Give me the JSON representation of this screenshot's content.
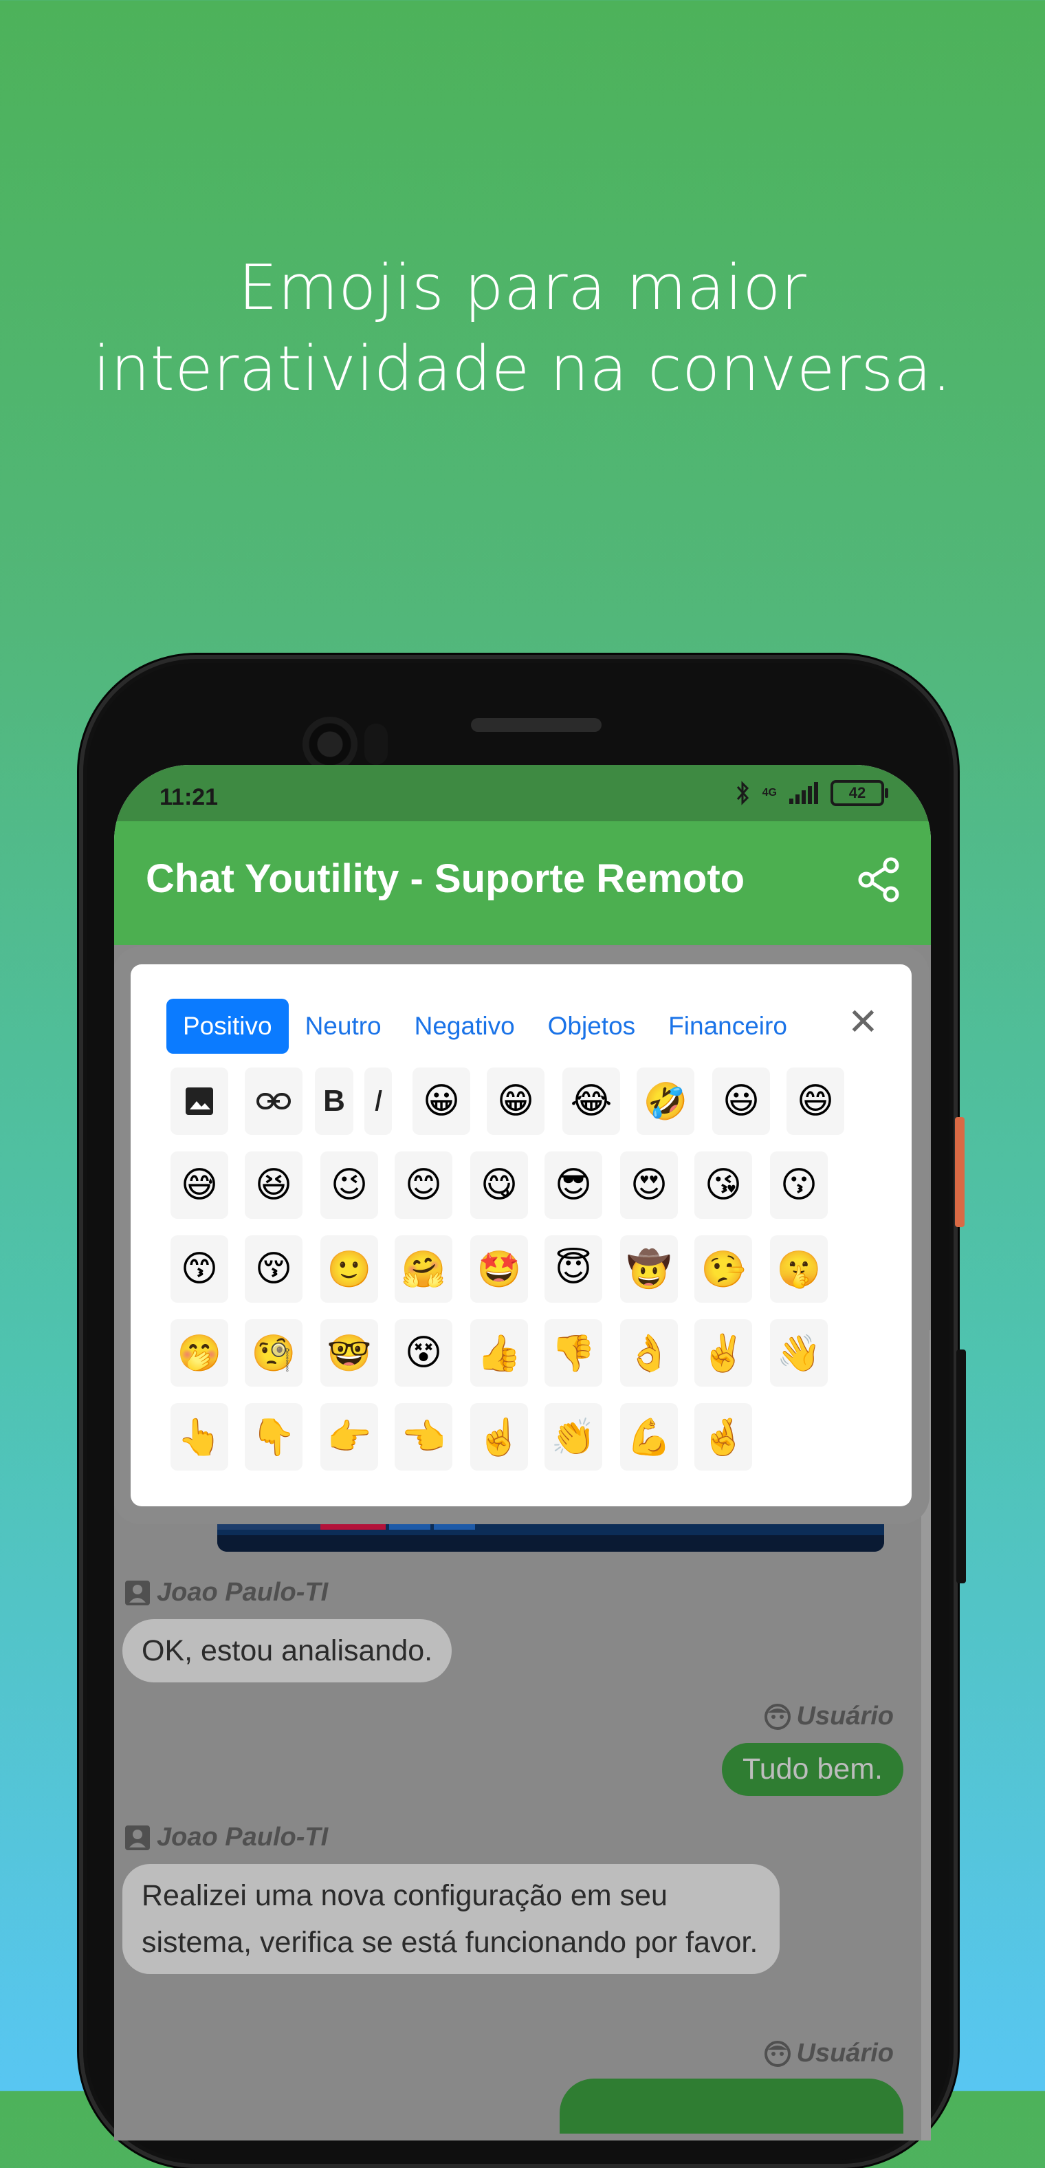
{
  "promo": {
    "line1": "Emojis para maior",
    "line2": "interatividade na conversa."
  },
  "status_bar": {
    "time": "11:21",
    "battery": "42",
    "network": "4G"
  },
  "app_bar": {
    "title": "Chat Youtility - Suporte Remoto"
  },
  "emoji_panel": {
    "tabs": [
      {
        "label": "Positivo",
        "active": true
      },
      {
        "label": "Neutro",
        "active": false
      },
      {
        "label": "Negativo",
        "active": false
      },
      {
        "label": "Objetos",
        "active": false
      },
      {
        "label": "Financeiro",
        "active": false
      }
    ],
    "close_label": "✕",
    "tools": [
      "image-icon",
      "link-icon",
      "B",
      "I"
    ],
    "rows": [
      [
        "😀",
        "😁",
        "😂",
        "🤣",
        "😃",
        "😄"
      ],
      [
        "😅",
        "😆",
        "😉",
        "😊",
        "😋",
        "😎",
        "😍",
        "😘",
        "😗"
      ],
      [
        "😙",
        "😚",
        "🙂",
        "🤗",
        "🤩",
        "😇",
        "🤠",
        "🤥",
        "🤫"
      ],
      [
        "🤭",
        "🧐",
        "🤓",
        "😵",
        "👍",
        "👎",
        "👌",
        "✌️",
        "👋"
      ],
      [
        "👆",
        "👇",
        "👉",
        "👈",
        "☝️",
        "👏",
        "💪",
        "🤞"
      ]
    ]
  },
  "messages": [
    {
      "sender": "Joao Paulo-TI",
      "side": "left",
      "text": "OK, estou analisando."
    },
    {
      "sender": "Usuário",
      "side": "right",
      "text": "Tudo bem."
    },
    {
      "sender": "Joao Paulo-TI",
      "side": "left",
      "text": "Realizei uma nova configuração em seu sistema, verifica se está funcionando por favor."
    },
    {
      "sender": "Usuário",
      "side": "right",
      "text": ""
    }
  ],
  "colors": {
    "app_bar": "#4caf50",
    "status_bar": "#3e8a42",
    "active_tab": "#0b7bff",
    "tab_text": "#1a73e8"
  }
}
